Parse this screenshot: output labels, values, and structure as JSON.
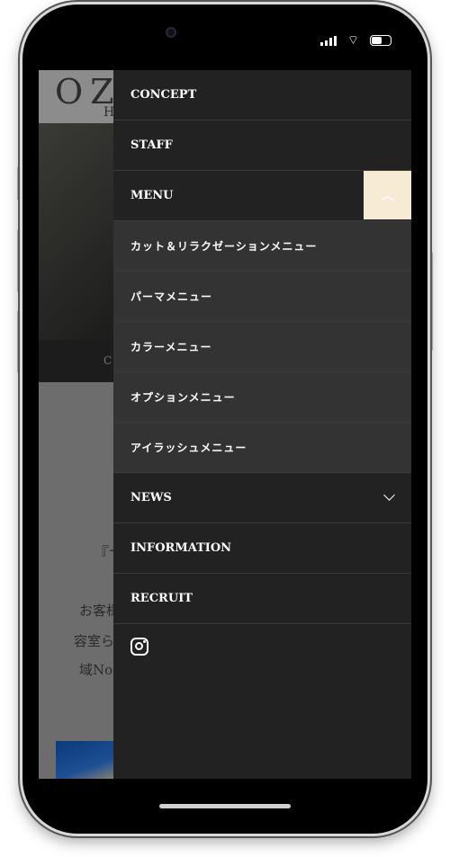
{
  "status_bar": {
    "icons": [
      "signal-icon",
      "wifi-icon",
      "battery-icon"
    ]
  },
  "background_page": {
    "logo": "OZ",
    "logo_sub": "H",
    "nav_fragment": "C",
    "heading_fragment": "『サ",
    "text_lines": [
      "お客様",
      "容室ら",
      "域No."
    ]
  },
  "menu": {
    "items": [
      {
        "label": "CONCEPT"
      },
      {
        "label": "STAFF"
      },
      {
        "label": "MENU",
        "expanded": true,
        "toggle_color": "#f7ebd3"
      }
    ],
    "submenu": [
      {
        "label": "カット＆リラクゼーションメニュー"
      },
      {
        "label": "パーマメニュー"
      },
      {
        "label": "カラーメニュー"
      },
      {
        "label": "オプションメニュー"
      },
      {
        "label": "アイラッシュメニュー"
      }
    ],
    "items2": [
      {
        "label": "NEWS",
        "expanded": false
      },
      {
        "label": "INFORMATION"
      },
      {
        "label": "RECRUIT"
      }
    ],
    "social_icon": "instagram-icon"
  }
}
